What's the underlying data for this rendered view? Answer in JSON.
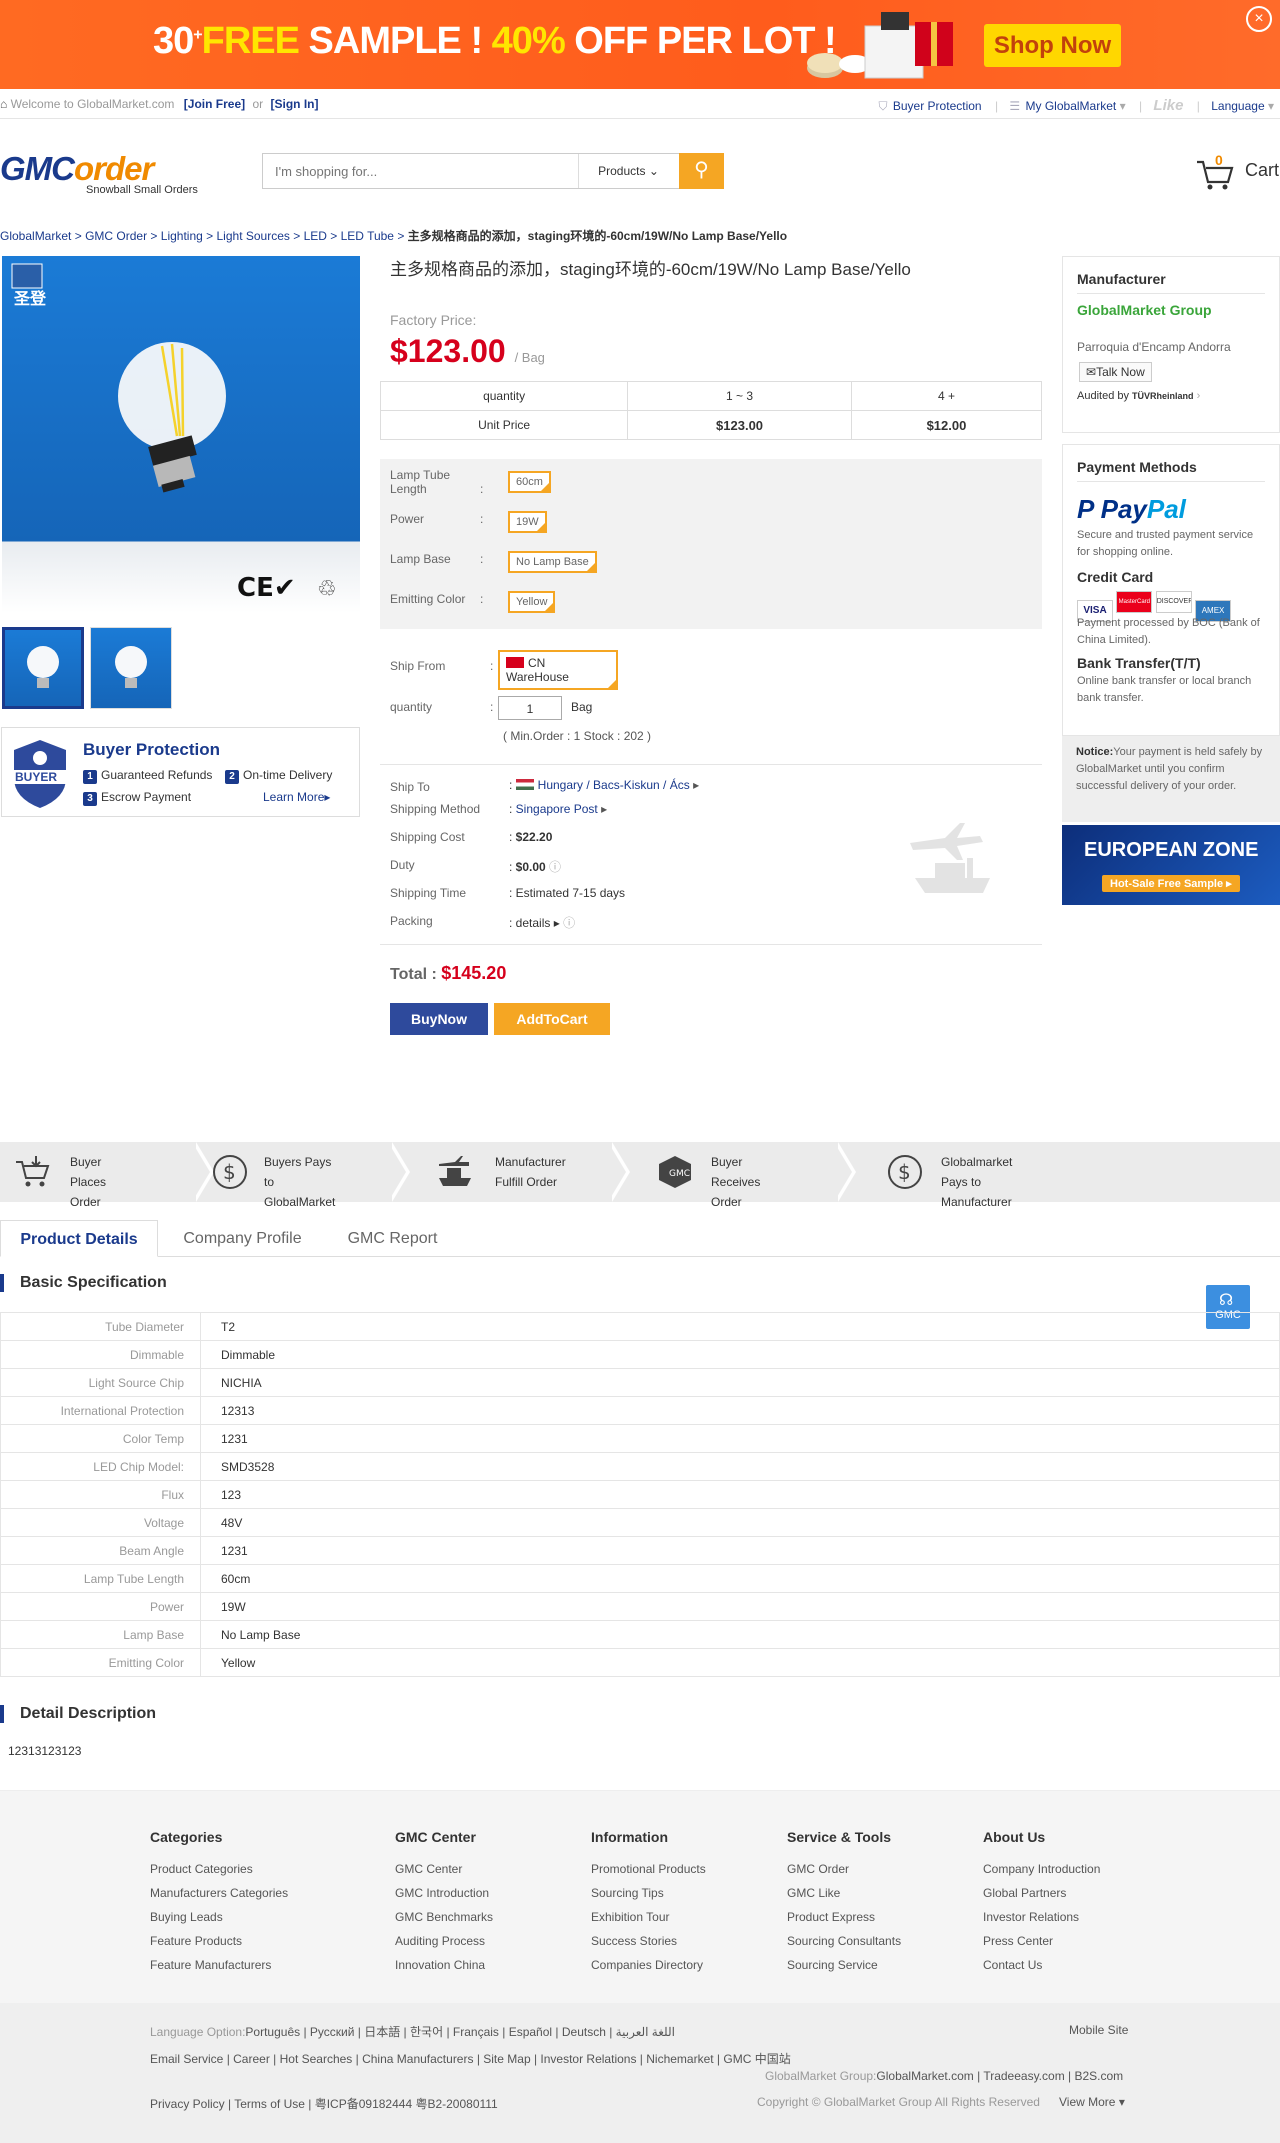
{
  "banner": {
    "num": "30",
    "plus": "+",
    "free": "FREE",
    "sample": " SAMPLE ! ",
    "pct": "40%",
    "off": " OFF PER LOT !",
    "shop_now": "Shop Now",
    "close": "×"
  },
  "topbar": {
    "welcome": "Welcome to GlobalMarket.com",
    "join": "[Join Free]",
    "or": "or",
    "signin": "[Sign In]",
    "buyer_protection": "Buyer Protection",
    "my_gm": "My GlobalMarket",
    "like": "Like",
    "language": "Language"
  },
  "header": {
    "logo_a": "GMC",
    "logo_b": "order",
    "tagline": "Snowball Small Orders",
    "search_placeholder": "I'm shopping for...",
    "search_category": "Products",
    "cart_count": "0",
    "cart_label": "Cart"
  },
  "breadcrumb": [
    "GlobalMarket",
    "GMC Order",
    "Lighting",
    "Light Sources",
    "LED",
    "LED Tube"
  ],
  "breadcrumb_current": "主多规格商品的添加，staging环境的-60cm/19W/No Lamp Base/Yello",
  "product": {
    "title": "主多规格商品的添加，staging环境的-60cm/19W/No Lamp Base/Yello",
    "factory_price_label": "Factory Price:",
    "price": "$123.00",
    "unit": "/ Bag",
    "table_head": [
      "quantity",
      "1 ~ 3",
      "4 +"
    ],
    "table_row_label": "Unit Price",
    "table_prices": [
      "$123.00",
      "$12.00"
    ],
    "attrs": [
      {
        "label": "Lamp Tube Length",
        "value": "60cm"
      },
      {
        "label": "Power",
        "value": "19W"
      },
      {
        "label": "Lamp Base",
        "value": "No Lamp Base"
      },
      {
        "label": "Emitting Color",
        "value": "Yellow"
      }
    ],
    "ship_from_label": "Ship From",
    "ship_from": "CN WareHouse",
    "quantity_label": "quantity",
    "quantity": "1",
    "quantity_unit": "Bag",
    "min_order": "( Min.Order : 1    Stock : 202 )",
    "ship_to_label": "Ship To",
    "ship_to": "Hungary / Bacs-Kiskun / Ács",
    "method_label": "Shipping Method",
    "method": "Singapore Post",
    "cost_label": "Shipping Cost",
    "cost": "$22.20",
    "duty_label": "Duty",
    "duty": "$0.00",
    "time_label": "Shipping Time",
    "time": "Estimated 7-15 days",
    "packing_label": "Packing",
    "packing": "details",
    "total_label": "Total :",
    "total": "$145.20",
    "buy_now": "BuyNow",
    "add_to_cart": "AddToCart"
  },
  "buyer_protection": {
    "badge": "BUYER",
    "title": "Buyer Protection",
    "items": [
      "Guaranteed Refunds",
      "On-time Delivery",
      "Escrow Payment"
    ],
    "learn_more": "Learn More"
  },
  "manufacturer": {
    "heading": "Manufacturer",
    "name": "GlobalMarket Group",
    "address": "Parroquia d'Encamp Andorra",
    "talk": "Talk Now",
    "audited": "Audited by",
    "auditor": "TÜVRheinland"
  },
  "payment": {
    "heading": "Payment Methods",
    "paypal_a": "Pay",
    "paypal_b": "Pal",
    "paypal_desc": "Secure and trusted payment service for shopping online.",
    "credit_title": "Credit Card",
    "cards": [
      "VISA",
      "MasterCard",
      "DISCOVER",
      "AMEX"
    ],
    "credit_desc": "Payment processed by BOC (Bank of China Limited).",
    "bank_title": "Bank Transfer(T/T)",
    "bank_desc": "Online bank transfer or local branch bank transfer.",
    "notice_label": "Notice:",
    "notice": "Your payment is held safely by GlobalMarket until you confirm successful delivery of your order."
  },
  "euro_banner": {
    "title": "EUROPEAN ZONE",
    "sub": "Hot-Sale Free Sample ▸"
  },
  "process": [
    {
      "line1": "Buyer",
      "line2": "Places Order"
    },
    {
      "line1": "Buyers Pays",
      "line2": "to GlobalMarket"
    },
    {
      "line1": "Manufacturer",
      "line2": "Fulfill Order"
    },
    {
      "line1": "Buyer",
      "line2": "Receives Order"
    },
    {
      "line1": "Globalmarket",
      "line2": "Pays to Manufacturer"
    }
  ],
  "tabs": [
    "Product Details",
    "Company Profile",
    "GMC Report"
  ],
  "basic_spec_title": "Basic Specification",
  "specs": [
    [
      "Tube Diameter",
      "T2"
    ],
    [
      "Dimmable",
      "Dimmable"
    ],
    [
      "Light Source Chip",
      "NICHIA"
    ],
    [
      "International Protection",
      "12313"
    ],
    [
      "Color Temp",
      "1231"
    ],
    [
      "LED Chip Model:",
      "SMD3528"
    ],
    [
      "Flux",
      "123"
    ],
    [
      "Voltage",
      "48V"
    ],
    [
      "Beam Angle",
      "1231"
    ],
    [
      "Lamp Tube Length",
      "60cm"
    ],
    [
      "Power",
      "19W"
    ],
    [
      "Lamp Base",
      "No Lamp Base"
    ],
    [
      "Emitting Color",
      "Yellow"
    ]
  ],
  "gmc_float": "GMC",
  "detail_title": "Detail Description",
  "detail_text": "12313123123",
  "footer": {
    "cols": [
      {
        "title": "Categories",
        "items": [
          "Product Categories",
          "Manufacturers Categories",
          "Buying Leads",
          "Feature Products",
          "Feature Manufacturers"
        ]
      },
      {
        "title": "GMC Center",
        "items": [
          "GMC Center",
          "GMC Introduction",
          "GMC Benchmarks",
          "Auditing Process",
          "Innovation China"
        ]
      },
      {
        "title": "Information",
        "items": [
          "Promotional Products",
          "Sourcing Tips",
          "Exhibition Tour",
          "Success Stories",
          "Companies Directory"
        ]
      },
      {
        "title": "Service & Tools",
        "items": [
          "GMC Order",
          "GMC Like",
          "Product Express",
          "Sourcing Consultants",
          "Sourcing Service"
        ]
      },
      {
        "title": "About Us",
        "items": [
          "Company Introduction",
          "Global Partners",
          "Investor Relations",
          "Press Center",
          "Contact Us"
        ]
      }
    ],
    "lang_label": "Language Option:",
    "languages": "Português | Русский | 日本語 | 한국어 | Français | Español | Deutsch | اللغة العربية",
    "mobile": "Mobile Site",
    "links": "Email Service | Career | Hot Searches | China Manufacturers | Site Map | Investor Relations | Nichemarket | GMC 中国站",
    "group_label": "GlobalMarket Group:",
    "group_links": "GlobalMarket.com | Tradeeasy.com | B2S.com",
    "policy": "Privacy Policy | Terms of Use | 粤ICP备09182444 粤B2-20080111",
    "copyright": "Copyright © GlobalMarket Group All Rights Reserved",
    "view_more": "View More"
  }
}
